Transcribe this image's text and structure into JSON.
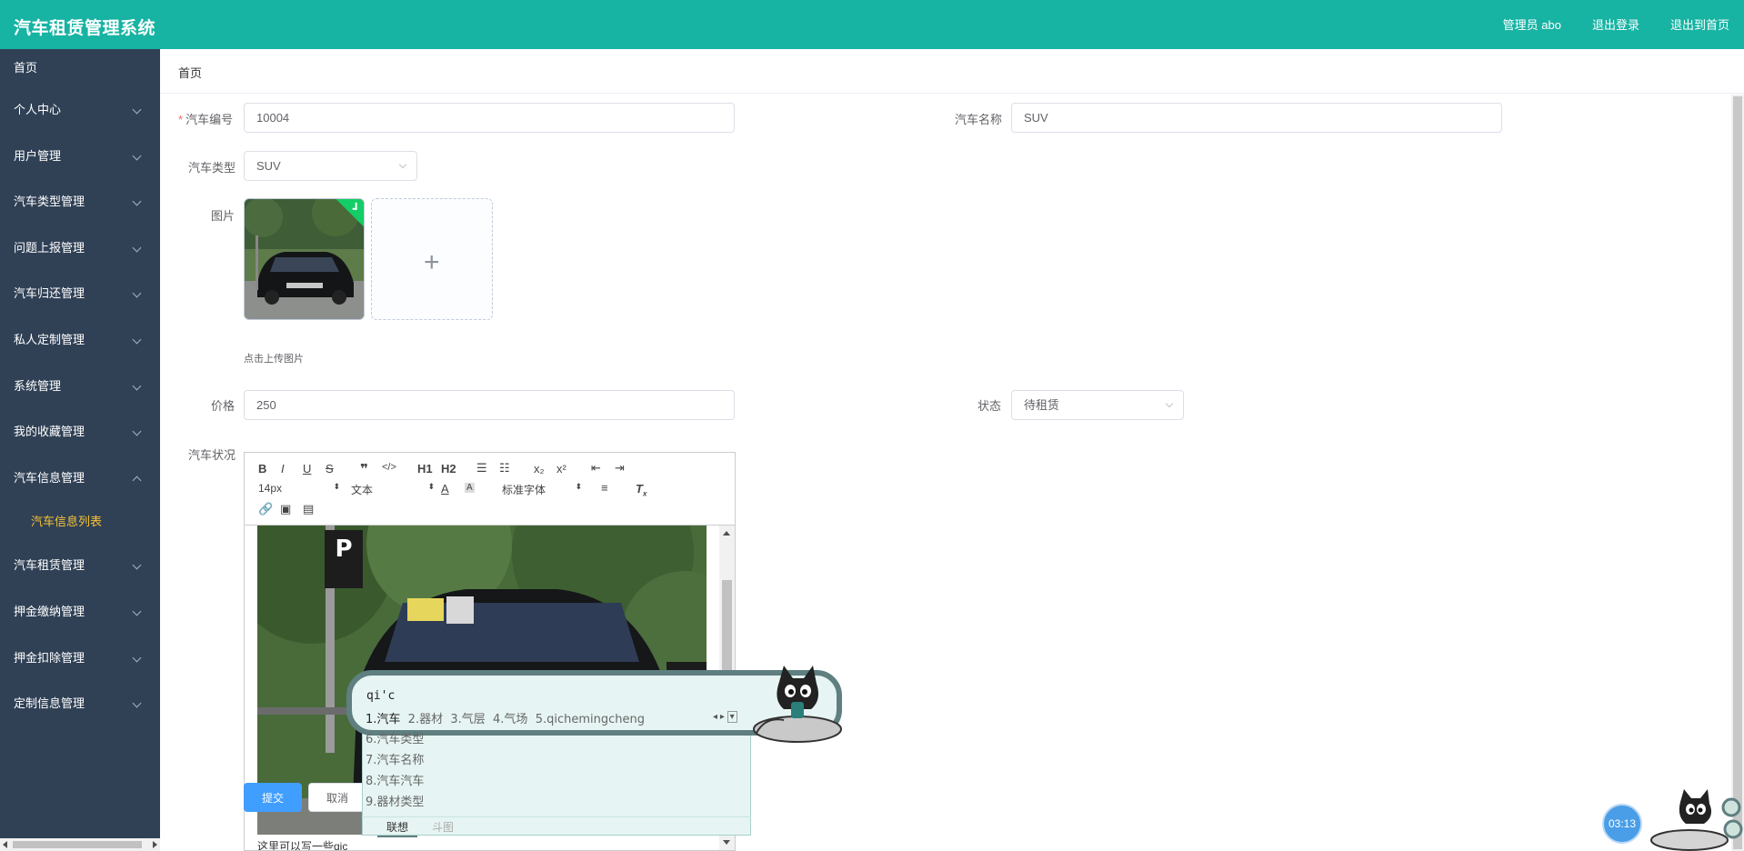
{
  "app": {
    "title": "汽车租赁管理系统"
  },
  "header": {
    "links": [
      "管理员 abo",
      "退出登录",
      "退出到首页"
    ]
  },
  "sidebar": {
    "items": [
      {
        "label": "首页",
        "expandable": false
      },
      {
        "label": "个人中心",
        "expandable": true
      },
      {
        "label": "用户管理",
        "expandable": true
      },
      {
        "label": "汽车类型管理",
        "expandable": true
      },
      {
        "label": "问题上报管理",
        "expandable": true
      },
      {
        "label": "汽车归还管理",
        "expandable": true
      },
      {
        "label": "私人定制管理",
        "expandable": true
      },
      {
        "label": "系统管理",
        "expandable": true
      },
      {
        "label": "我的收藏管理",
        "expandable": true
      },
      {
        "label": "汽车信息管理",
        "expandable": true,
        "expanded": true
      },
      {
        "label": "汽车租赁管理",
        "expandable": true
      },
      {
        "label": "押金缴纳管理",
        "expandable": true
      },
      {
        "label": "押金扣除管理",
        "expandable": true
      },
      {
        "label": "定制信息管理",
        "expandable": true
      }
    ],
    "sub_item_active": "汽车信息列表"
  },
  "breadcrumb": "首页",
  "form": {
    "car_number_label": "汽车编号",
    "car_number_value": "10004",
    "car_name_label": "汽车名称",
    "car_name_value": "SUV",
    "car_type_label": "汽车类型",
    "car_type_value": "SUV",
    "image_label": "图片",
    "upload_tip": "点击上传图片",
    "price_label": "价格",
    "price_value": "250",
    "status_label": "状态",
    "status_value": "待租赁",
    "condition_label": "汽车状况",
    "submit_label": "提交",
    "cancel_label": "取消"
  },
  "editor": {
    "font_size": "14px",
    "block_format": "文本",
    "font_family": "标准字体",
    "body_text": "这里可以写一些qic",
    "h1": "H1",
    "h2": "H2"
  },
  "ime": {
    "composition": "qi'c",
    "candidates_row": [
      "1.汽车",
      "2.器材",
      "3.气层",
      "4.气场",
      "5.qichemingcheng"
    ],
    "candidates_list": [
      "6.汽车类型",
      "7.汽车名称",
      "8.汽车汽车",
      "9.器材类型"
    ],
    "tab_active": "联想",
    "tab_inactive": "斗图"
  },
  "timer": "03:13",
  "colors": {
    "header_bg": "#17b3a3",
    "sidebar_bg": "#304156",
    "active_sub": "#f7c234",
    "primary": "#409eff"
  }
}
